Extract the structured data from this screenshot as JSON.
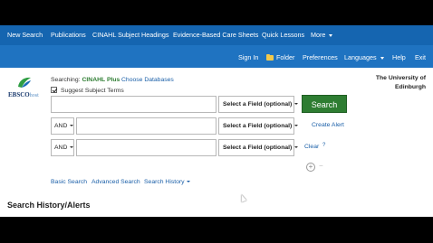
{
  "topnav": {
    "items": [
      {
        "label": "New Search"
      },
      {
        "label": "Publications"
      },
      {
        "label": "CINAHL Subject Headings"
      },
      {
        "label": "Evidence-Based Care Sheets"
      },
      {
        "label": "Quick Lessons"
      },
      {
        "label": "More"
      }
    ]
  },
  "subnav": {
    "sign_in": "Sign In",
    "folder": "Folder",
    "preferences": "Preferences",
    "languages": "Languages",
    "help": "Help",
    "exit": "Exit"
  },
  "logo": {
    "ebsco": "EBSCO",
    "host": "host"
  },
  "search": {
    "searching_label": "Searching:",
    "database": "CINAHL Plus",
    "choose_databases": "Choose Databases",
    "suggest_subject_terms": "Suggest Subject Terms",
    "suggest_checked": true,
    "rows": [
      {
        "operator": "",
        "value": "",
        "field": "Select a Field (optional)"
      },
      {
        "operator": "AND",
        "value": "",
        "field": "Select a Field (optional)"
      },
      {
        "operator": "AND",
        "value": "",
        "field": "Select a Field (optional)"
      }
    ],
    "search_button": "Search",
    "create_alert": "Create Alert",
    "clear": "Clear",
    "help_mark": "?",
    "add_row": "+",
    "remove_row": "−"
  },
  "institution": "The University of Edinburgh",
  "search_modes": {
    "basic": "Basic Search",
    "advanced": "Advanced Search",
    "history": "Search History"
  },
  "history_heading": "Search History/Alerts",
  "colors": {
    "topnav": "#1565b0",
    "subnav": "#1f73c1",
    "search_button": "#2e7d32",
    "link": "#1a5fa8"
  }
}
